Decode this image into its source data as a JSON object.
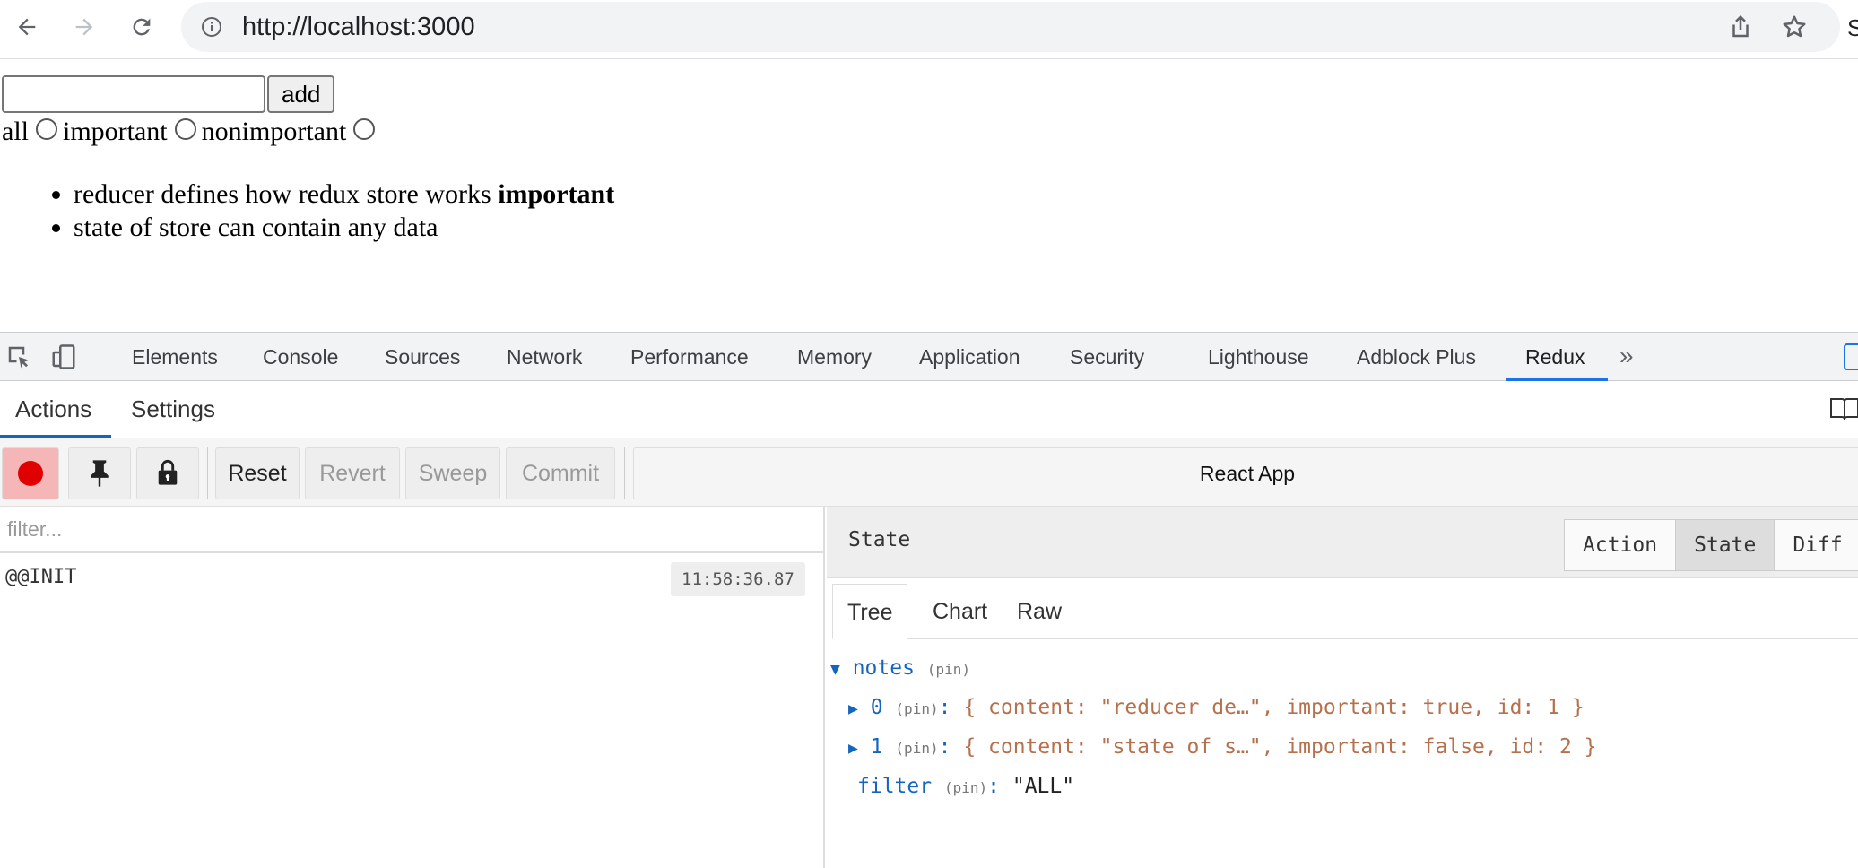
{
  "browser": {
    "url": "http://localhost:3000",
    "icons": [
      "back-arrow-icon",
      "forward-arrow-icon",
      "reload-icon",
      "info-icon",
      "share-icon",
      "star-icon"
    ]
  },
  "page": {
    "add_button": "add",
    "input_value": "",
    "filters": [
      {
        "label": "all",
        "selected": false
      },
      {
        "label": "important",
        "selected": false
      },
      {
        "label": "nonimportant",
        "selected": false
      }
    ],
    "notes": [
      {
        "content": "reducer defines how redux store works",
        "tag": "important"
      },
      {
        "content": "state of store can contain any data",
        "tag": ""
      }
    ]
  },
  "devtools": {
    "tabs": [
      "Elements",
      "Console",
      "Sources",
      "Network",
      "Performance",
      "Memory",
      "Application",
      "Security",
      "Lighthouse",
      "Adblock Plus",
      "Redux"
    ],
    "active_tab": "Redux",
    "more": "»",
    "redux": {
      "tabs": [
        "Actions",
        "Settings"
      ],
      "active_tab": "Actions",
      "toolbar": {
        "reset": "Reset",
        "revert": "Revert",
        "sweep": "Sweep",
        "commit": "Commit",
        "instance": "React App"
      },
      "filter_placeholder": "filter...",
      "actions": [
        {
          "name": "@@INIT",
          "time": "11:58:36.87"
        }
      ],
      "inspector": {
        "title": "State",
        "modes": [
          "Action",
          "State",
          "Diff"
        ],
        "active_mode": "State",
        "views": [
          "Tree",
          "Chart",
          "Raw"
        ],
        "active_view": "Tree",
        "tree": {
          "notes_key": "notes",
          "pin": "(pin)",
          "item0_key": "0",
          "item0_value": "{ content: \"reducer de…\", important: true, id: 1 }",
          "item1_key": "1",
          "item1_value": "{ content: \"state of s…\", important: false, id: 2 }",
          "filter_key": "filter",
          "filter_value": "\"ALL\""
        }
      }
    }
  },
  "colors": {
    "accent": "#1a73e8",
    "record": "#e00000",
    "key": "#1565c0",
    "value": "#b5714d"
  }
}
